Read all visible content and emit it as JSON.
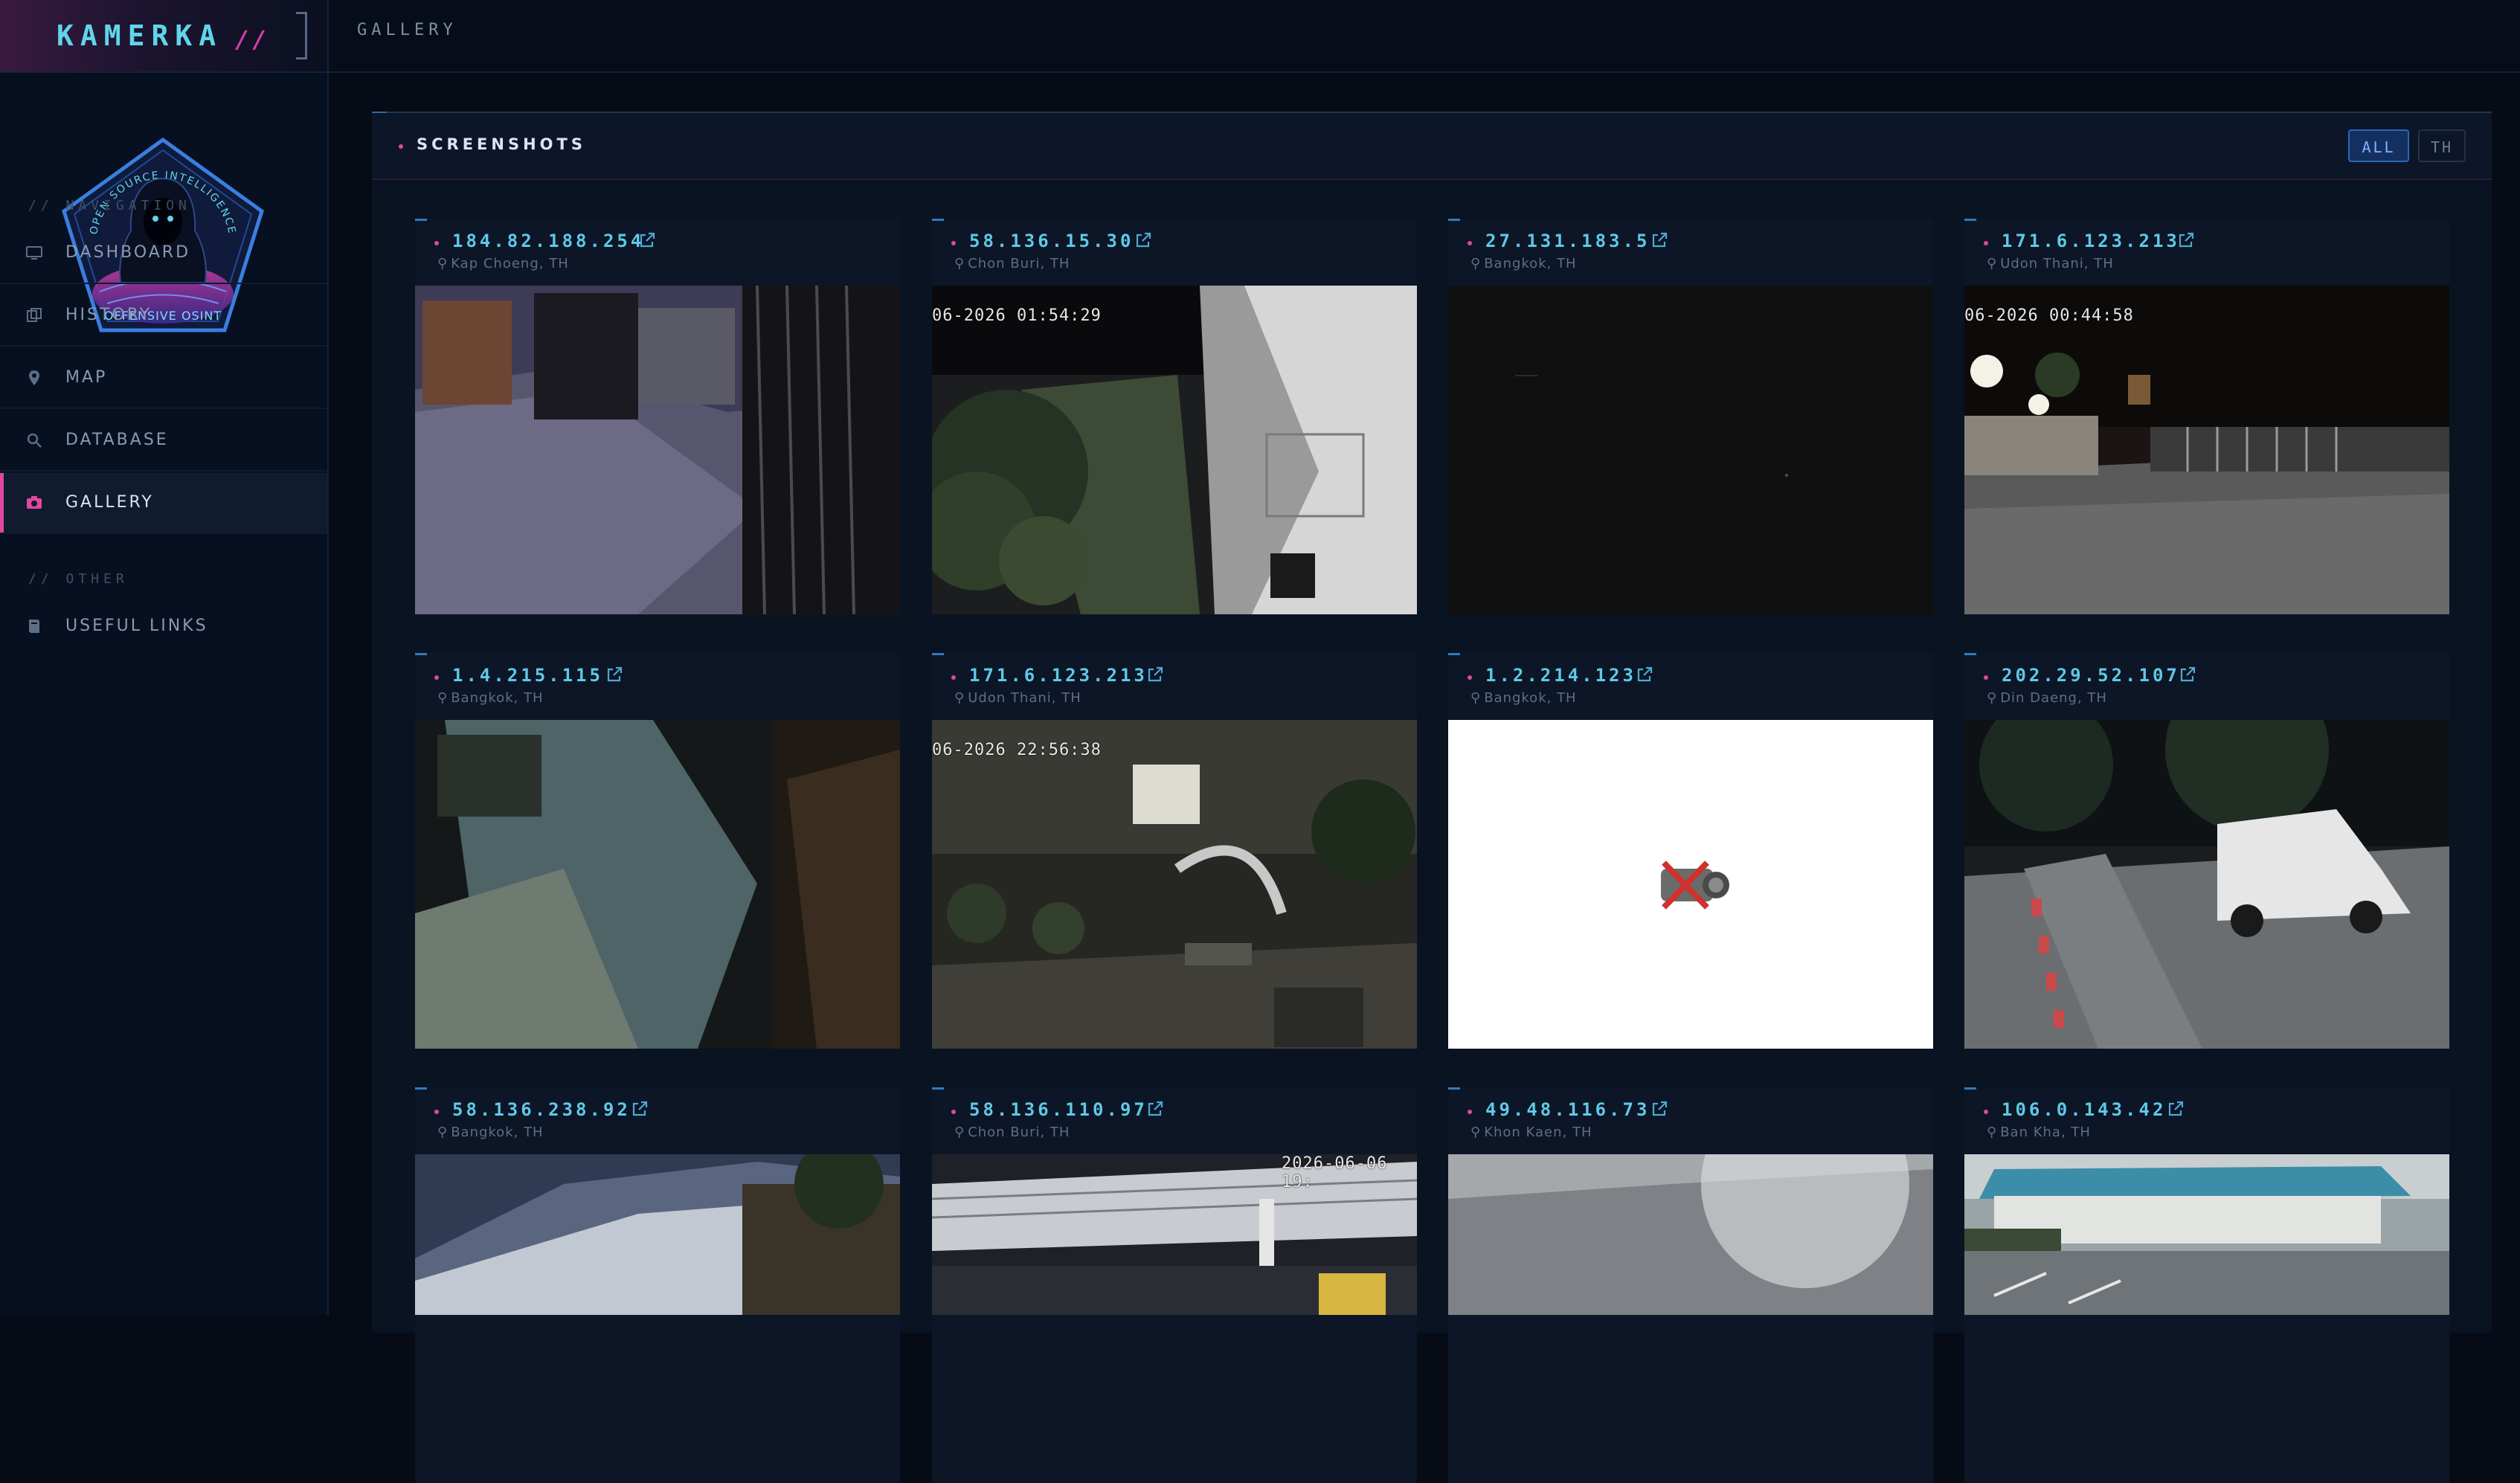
{
  "app": {
    "brand_name": "KAMERKA",
    "brand_suffix": "//",
    "page_crumb": "GALLERY",
    "logo": {
      "top_text": "OPEN SOURCE INTELLIGENCE",
      "bottom_text": "OFFENSIVE OSINT"
    }
  },
  "sidebar": {
    "section_navigation": "// NAVIGATION",
    "section_other": "// OTHER",
    "items": [
      {
        "label": "DASHBOARD",
        "icon": "monitor-icon"
      },
      {
        "label": "HISTORY",
        "icon": "history-icon"
      },
      {
        "label": "MAP",
        "icon": "map-pin-icon"
      },
      {
        "label": "DATABASE",
        "icon": "search-icon"
      },
      {
        "label": "GALLERY",
        "icon": "camera-icon",
        "active": true
      }
    ],
    "other_items": [
      {
        "label": "USEFUL LINKS",
        "icon": "book-icon"
      }
    ]
  },
  "panel": {
    "title": "SCREENSHOTS",
    "filters": {
      "all": "ALL",
      "th": "TH",
      "selected": "ALL"
    }
  },
  "cameras": [
    {
      "ip": "184.82.188.254",
      "location": "Kap Choeng, TH"
    },
    {
      "ip": "58.136.15.30",
      "location": "Chon Buri, TH",
      "timestamp": "06-2026 01:54:29"
    },
    {
      "ip": "27.131.183.5",
      "location": "Bangkok, TH"
    },
    {
      "ip": "171.6.123.213",
      "location": "Udon Thani, TH",
      "timestamp": "06-2026 00:44:58"
    },
    {
      "ip": "1.4.215.115",
      "location": "Bangkok, TH"
    },
    {
      "ip": "171.6.123.213",
      "location": "Udon Thani, TH",
      "timestamp": "06-2026 22:56:38"
    },
    {
      "ip": "1.2.214.123",
      "location": "Bangkok, TH"
    },
    {
      "ip": "202.29.52.107",
      "location": "Din Daeng, TH"
    },
    {
      "ip": "58.136.238.92",
      "location": "Bangkok, TH"
    },
    {
      "ip": "58.136.110.97",
      "location": "Chon Buri, TH",
      "timestamp": "2026-06-06 19:"
    },
    {
      "ip": "49.48.116.73",
      "location": "Khon Kaen, TH"
    },
    {
      "ip": "106.0.143.42",
      "location": "Ban Kha, TH"
    }
  ],
  "colors": {
    "accent_cyan": "#5fc9e6",
    "accent_pink": "#e0489f",
    "accent_blue": "#2e66b8",
    "background": "#060b16"
  }
}
